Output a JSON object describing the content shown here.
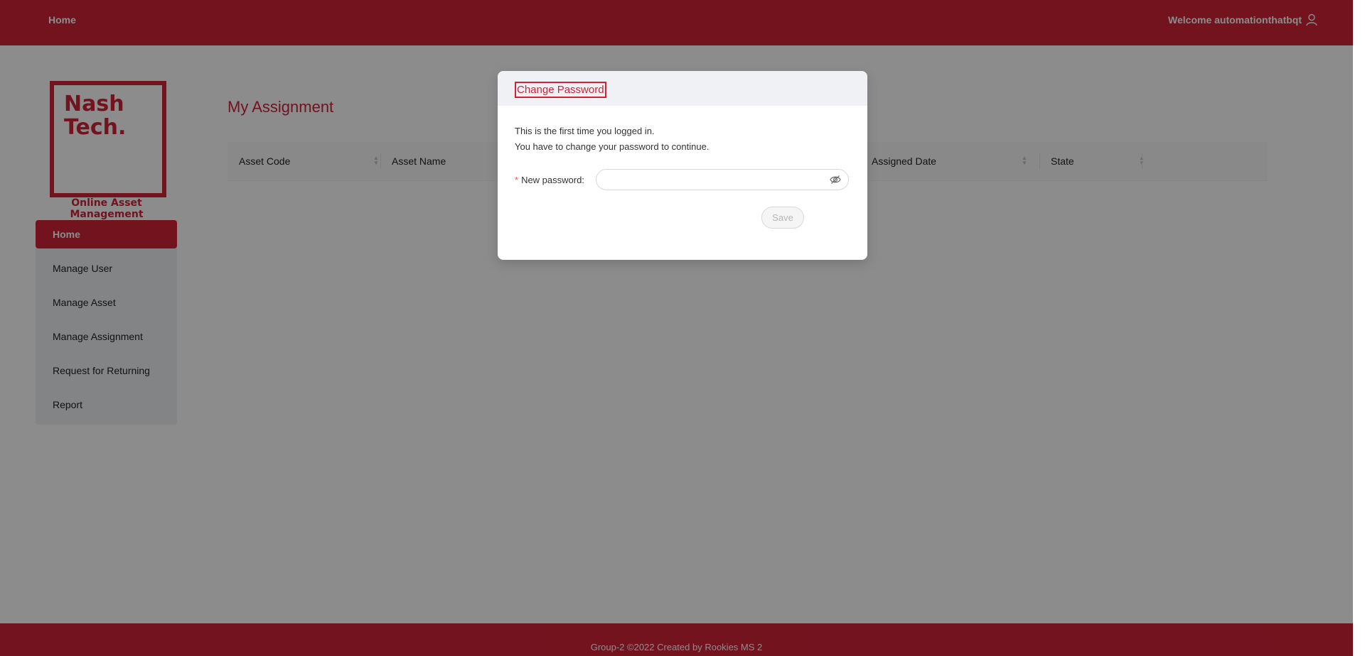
{
  "header": {
    "home_label": "Home",
    "welcome_text": "Welcome automationthatbqt",
    "user_icon": "user-icon"
  },
  "sidebar": {
    "logo_text": "Nash\nTech.",
    "app_name": "Online Asset Management",
    "items": [
      {
        "label": "Home",
        "active": true
      },
      {
        "label": "Manage User",
        "active": false
      },
      {
        "label": "Manage Asset",
        "active": false
      },
      {
        "label": "Manage Assignment",
        "active": false
      },
      {
        "label": "Request for Returning",
        "active": false
      },
      {
        "label": "Report",
        "active": false
      }
    ]
  },
  "main": {
    "title": "My Assignment",
    "columns": [
      "Asset Code",
      "Asset Name",
      "Assigned Date",
      "State"
    ],
    "rows": []
  },
  "modal": {
    "title": "Change Password",
    "message_line1": "This is the first time you logged in.",
    "message_line2": "You have to change your password to continue.",
    "new_password_label": "New password",
    "new_password_value": "",
    "save_label": "Save"
  },
  "footer": {
    "text": "Group-2 ©2022 Created by Rookies MS 2"
  },
  "colors": {
    "brand": "#cf2338",
    "sidebar_bg": "#eff1f5"
  }
}
